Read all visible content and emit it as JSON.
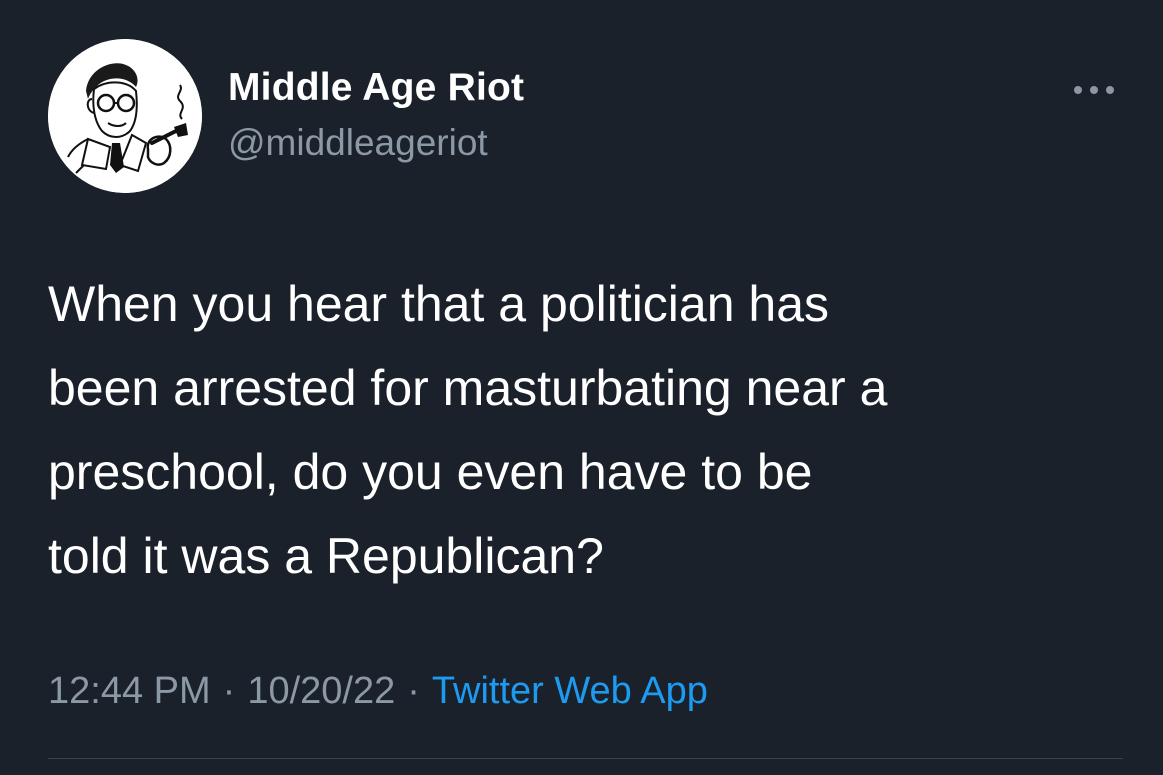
{
  "author": {
    "display_name": "Middle Age Riot",
    "handle": "@middleageriot",
    "avatar_icon": "vintage-man-with-pipe-illustration"
  },
  "menu": {
    "icon": "more-horizontal-icon"
  },
  "tweet": {
    "text": "When you hear that a politician has\nbeen arrested for masturbating near a\npreschool, do you even have to be\ntold it was a Republican?",
    "time": "12:44 PM",
    "separator": "·",
    "date": "10/20/22",
    "source": "Twitter Web App"
  },
  "colors": {
    "background": "#1b212b",
    "primary_text": "#ffffff",
    "secondary_text": "#8b98a5",
    "link": "#1d9bf0"
  }
}
